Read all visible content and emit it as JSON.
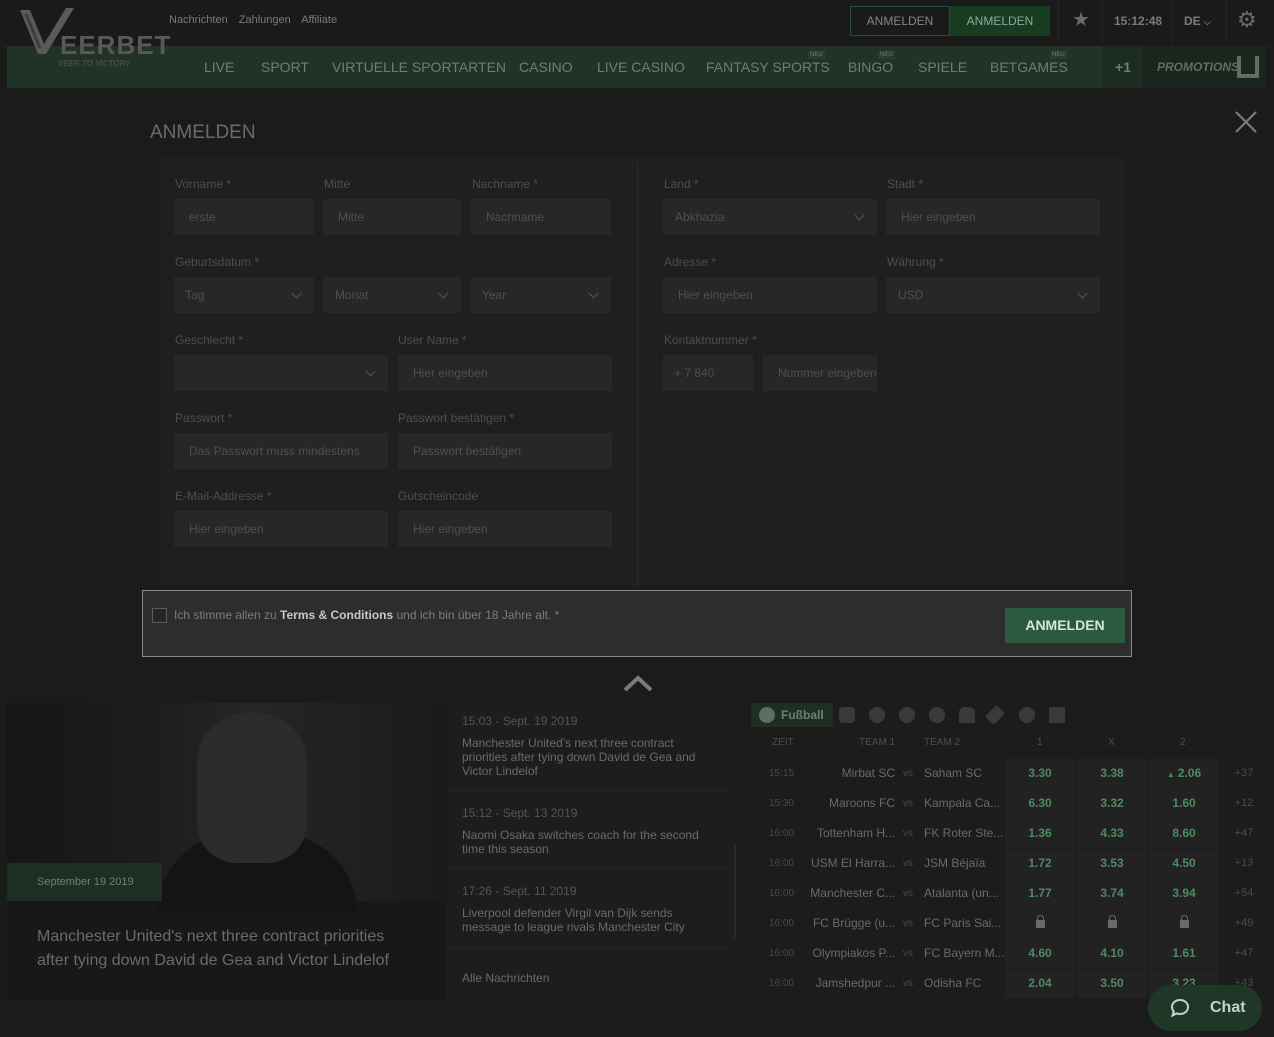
{
  "header": {
    "brand_name": "EERBET",
    "brand_tagline": "VEER TO VICTORY",
    "top_links": [
      "Nachrichten",
      "Zahlungen",
      "Affiliate"
    ],
    "login_outline_label": "ANMELDEN",
    "login_solid_label": "ANMELDEN",
    "time": "15:12:48",
    "language": "DE"
  },
  "nav": {
    "items": [
      {
        "label": "LIVE",
        "badge": ""
      },
      {
        "label": "SPORT",
        "badge": ""
      },
      {
        "label": "VIRTUELLE SPORTARTEN",
        "badge": ""
      },
      {
        "label": "CASINO",
        "badge": ""
      },
      {
        "label": "LIVE CASINO",
        "badge": ""
      },
      {
        "label": "FANTASY SPORTS",
        "badge": "NEU"
      },
      {
        "label": "BINGO",
        "badge": "NEU"
      },
      {
        "label": "SPIELE",
        "badge": ""
      },
      {
        "label": "BETGAMES",
        "badge": "NEU"
      }
    ],
    "more_label": "+1",
    "promotions_label": "PROMOTIONS"
  },
  "modal": {
    "title": "ANMELDEN",
    "fields": {
      "vorname": {
        "label": "Vorname *",
        "value": "erste"
      },
      "mitte": {
        "label": "Mitte",
        "placeholder": "Mitte"
      },
      "nachname": {
        "label": "Nachname *",
        "placeholder": "Nachname"
      },
      "geburtsdatum": {
        "label": "Geburtsdatum *",
        "day": "Tag",
        "month": "Monat",
        "year": "Year"
      },
      "geschlecht": {
        "label": "Geschlecht *",
        "value": ""
      },
      "username": {
        "label": "User Name *",
        "placeholder": "Hier eingeben"
      },
      "passwort": {
        "label": "Passwort *",
        "placeholder": "Das Passwort muss mindestens"
      },
      "passwort_bestaetigen": {
        "label": "Passwort bestätigen *",
        "placeholder": "Passwort bestätigen"
      },
      "email": {
        "label": "E-Mail-Addresse *",
        "placeholder": "Hier eingeben"
      },
      "gutschein": {
        "label": "Gutscheincode",
        "placeholder": "Hier eingeben"
      },
      "land": {
        "label": "Land *",
        "value": "Abkhazia"
      },
      "stadt": {
        "label": "Stadt *",
        "placeholder": "Hier eingeben"
      },
      "adresse": {
        "label": "Adresse *",
        "placeholder": "Hier eingeben"
      },
      "waehrung": {
        "label": "Währung *",
        "value": "USD"
      },
      "kontakt": {
        "label": "Kontaktnummer *",
        "code": "+ 7 840",
        "placeholder": "Nummer eingeben"
      }
    },
    "terms_prefix": "Ich stimme allen zu ",
    "terms_link": "Terms & Conditions",
    "terms_suffix": " und ich bin über 18 Jahre alt. *",
    "submit_label": "ANMELDEN"
  },
  "news": {
    "hero_date": "September 19 2019",
    "hero_caption": "Manchester United's next three contract priorities after tying down David de Gea and Victor Lindelof",
    "items": [
      {
        "meta": "15:03 - Sept. 19 2019",
        "headline": "Manchester United's next three contract priorities after tying down David de Gea and Victor Lindelof"
      },
      {
        "meta": "15:12 - Sept. 13 2019",
        "headline": "Naomi Osaka switches coach for the second time this season"
      },
      {
        "meta": "17:26 - Sept. 11 2019",
        "headline": "Liverpool defender Virgil van Dijk sends message to league rivals Manchester City"
      }
    ],
    "all_label": "Alle Nachrichten"
  },
  "odds": {
    "active_sport": "Fußball",
    "columns": [
      "ZEIT",
      "TEAM 1",
      "TEAM 2",
      "1",
      "X",
      "2"
    ],
    "vs_label": "vs",
    "rows": [
      {
        "time": "15:15",
        "team1": "Mirbat SC",
        "team2": "Saham SC",
        "o1": "3.30",
        "ox": "3.38",
        "o2": "2.06",
        "more": "+37",
        "locked": false,
        "up2": true
      },
      {
        "time": "15:30",
        "team1": "Maroons FC",
        "team2": "Kampala Ca...",
        "o1": "6.30",
        "ox": "3.32",
        "o2": "1.60",
        "more": "+12",
        "locked": false,
        "up2": false
      },
      {
        "time": "16:00",
        "team1": "Tottenham H...",
        "team2": "FK Roter Ste...",
        "o1": "1.36",
        "ox": "4.33",
        "o2": "8.60",
        "more": "+47",
        "locked": false,
        "up2": false
      },
      {
        "time": "16:00",
        "team1": "USM El Harra...",
        "team2": "JSM Béjaïa",
        "o1": "1.72",
        "ox": "3.53",
        "o2": "4.50",
        "more": "+13",
        "locked": false,
        "up2": false
      },
      {
        "time": "16:00",
        "team1": "Manchester C...",
        "team2": "Atalanta (un...",
        "o1": "1.77",
        "ox": "3.74",
        "o2": "3.94",
        "more": "+54",
        "locked": false,
        "up2": false
      },
      {
        "time": "16:00",
        "team1": "FC Brügge (u...",
        "team2": "FC Paris Sai...",
        "o1": "",
        "ox": "",
        "o2": "",
        "more": "+49",
        "locked": true,
        "up2": false
      },
      {
        "time": "16:00",
        "team1": "Olympiakos P...",
        "team2": "FC Bayern M...",
        "o1": "4.60",
        "ox": "4.10",
        "o2": "1.61",
        "more": "+47",
        "locked": false,
        "up2": false
      },
      {
        "time": "16:00",
        "team1": "Jamshedpur ...",
        "team2": "Odisha FC",
        "o1": "2.04",
        "ox": "3.50",
        "o2": "3.23",
        "more": "+43",
        "locked": false,
        "up2": false
      }
    ]
  },
  "chat": {
    "label": "Chat"
  },
  "colors": {
    "accent": "#2b5b3e",
    "nav_bg": "#213326",
    "odds_green": "#4e8a62"
  }
}
